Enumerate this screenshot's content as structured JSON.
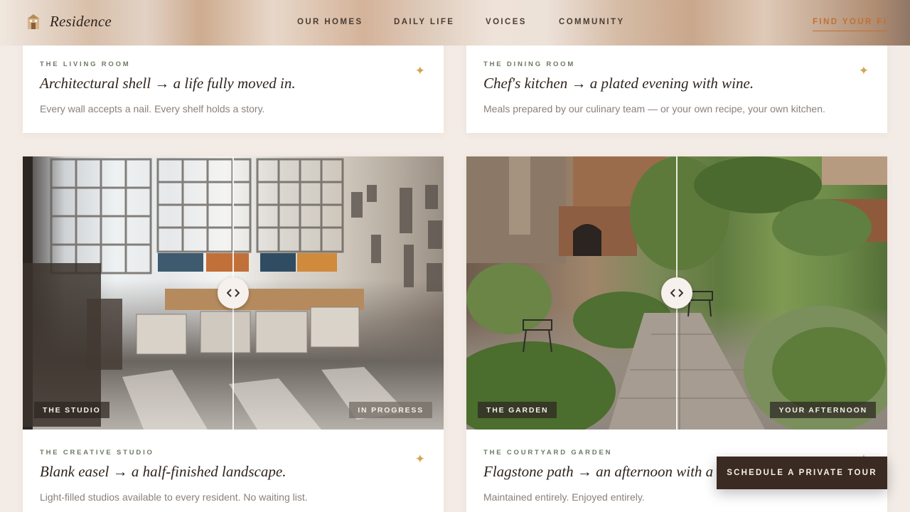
{
  "nav": {
    "brand": "Residence",
    "links": [
      "OUR HOMES",
      "DAILY LIFE",
      "VOICES",
      "COMMUNITY"
    ],
    "cta": "FIND YOUR FI"
  },
  "cards": [
    {
      "eyebrow": "THE LIVING ROOM",
      "headline": "Architectural shell → a life fully moved in.",
      "description": "Every wall accepts a nail. Every shelf holds a story."
    },
    {
      "eyebrow": "THE DINING ROOM",
      "headline": "Chef's kitchen → a plated evening with wine.",
      "description": "Meals prepared by our culinary team — or your own recipe, your own kitchen."
    },
    {
      "eyebrow": "THE CREATIVE STUDIO",
      "headline": "Blank easel → a half-finished landscape.",
      "description": "Light-filled studios available to every resident. No waiting list."
    },
    {
      "eyebrow": "THE COURTYARD GARDEN",
      "headline": "Flagstone path → an afternoon with a bo",
      "description": "Maintained entirely. Enjoyed entirely."
    }
  ],
  "compare": [
    {
      "before_label": "THE STUDIO",
      "after_label": "IN PROGRESS"
    },
    {
      "before_label": "THE GARDEN",
      "after_label": "YOUR AFTERNOON"
    }
  ],
  "sparkle_icon": "sparkle-icon",
  "handle_icon": "compare-arrows-icon",
  "tour_button": "SCHEDULE A PRIVATE TOUR",
  "colors": {
    "accent": "#c46f33",
    "sparkle": "#d2a553",
    "button": "#3a2a22",
    "eyebrow": "#6b7a63"
  }
}
